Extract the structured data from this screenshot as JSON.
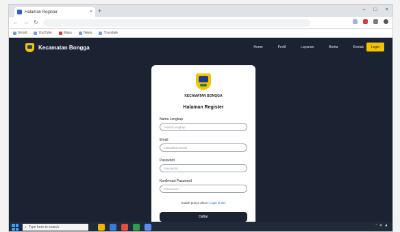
{
  "browser": {
    "tab_title": "Halaman Register",
    "url": "",
    "bookmarks": [
      {
        "label": "Gmail"
      },
      {
        "label": "YouTube"
      },
      {
        "label": "Maps"
      },
      {
        "label": "News"
      },
      {
        "label": "Translate"
      }
    ]
  },
  "nav": {
    "brand": "Kecamatan Bongga",
    "menu": [
      "Home",
      "Profil",
      "Layanan",
      "Berita",
      "Kontak"
    ],
    "login_button": "Login"
  },
  "card": {
    "org": "KECAMATAN BONGGA",
    "title": "Halaman Register",
    "fields": [
      {
        "label": "Nama Lengkap",
        "placeholder": "Nama Lengkap"
      },
      {
        "label": "Email",
        "placeholder": "Masukkan Email"
      },
      {
        "label": "Password",
        "placeholder": "Password"
      },
      {
        "label": "Konfirmasi Password",
        "placeholder": "Password"
      }
    ],
    "login_prompt": "Sudah punya akun?",
    "login_link": "Login di sini",
    "submit": "Daftar"
  },
  "taskbar": {
    "search_placeholder": "Type here to search",
    "time": "",
    "date": ""
  },
  "colors": {
    "navy": "#1b2333",
    "accent_yellow": "#f2c400",
    "link_blue": "#2a6bd6"
  }
}
